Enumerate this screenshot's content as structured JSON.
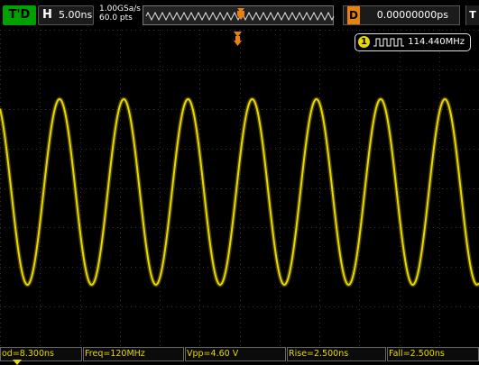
{
  "header": {
    "mode_label": "T'D",
    "timebase_letter": "H",
    "timebase_value": "5.00ns",
    "sample_rate": "1.00GSa/s",
    "memory_depth": "60.0  pts",
    "delay_letter": "D",
    "delay_value": "0.00000000ps",
    "trigger_edge_label": "T"
  },
  "frequency_counter": {
    "channel": "1",
    "value": "114.440MHz"
  },
  "waveform": {
    "channel_color": "#e8d800",
    "trigger_marker_color": "#e8820c",
    "cycles_visible": 7
  },
  "measurements": [
    "od=8.300ns",
    "Freq=120MHz",
    "Vpp=4.60 V",
    "Rise=2.500ns",
    "Fall=2.500ns"
  ],
  "icons": {
    "memory": "memory-overview-icon",
    "trigger_position": "trigger-position-icon",
    "square_wave": "square-wave-icon"
  }
}
